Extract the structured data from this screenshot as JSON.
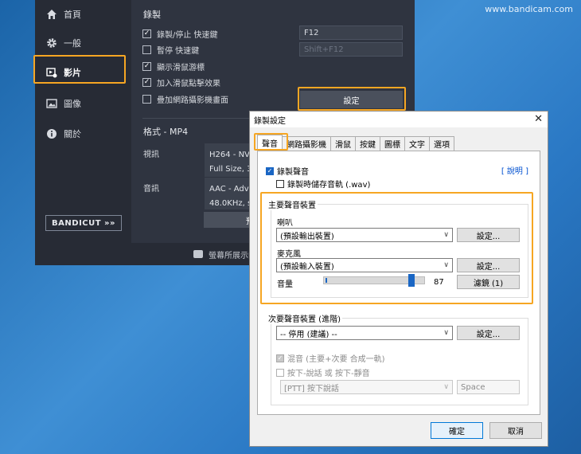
{
  "watermark": "www.bandicam.com",
  "sidebar": {
    "items": [
      {
        "label": "首頁",
        "icon": "home-icon"
      },
      {
        "label": "一般",
        "icon": "gear-icon"
      },
      {
        "label": "影片",
        "icon": "video-settings-icon"
      },
      {
        "label": "圖像",
        "icon": "image-icon"
      },
      {
        "label": "關於",
        "icon": "info-icon"
      }
    ],
    "active": "影片",
    "logo": "BANDICUT »»"
  },
  "record": {
    "title": "錄製",
    "options": [
      {
        "label": "錄製/停止 快速鍵",
        "checked": true
      },
      {
        "label": "暫停 快速鍵",
        "checked": false
      },
      {
        "label": "顯示滑鼠游標",
        "checked": true
      },
      {
        "label": "加入滑鼠點擊效果",
        "checked": true
      },
      {
        "label": "疊加網路攝影機畫面",
        "checked": false
      }
    ],
    "hotkey_record": "F12",
    "hotkey_pause": "Shift+F12",
    "settings_button": "設定"
  },
  "format": {
    "title": "格式 - MP4",
    "video_label": "視訊",
    "video_line1": "H264 - NVIDIA",
    "video_line2": "Full Size, 30fps",
    "audio_label": "音訊",
    "audio_line1": "AAC - Advanced",
    "audio_line2": "48.0KHz, stereo",
    "preset_button": "預"
  },
  "footer": {
    "text": "螢幕所展示的任何內容都"
  },
  "dialog": {
    "title": "錄製設定",
    "tabs": [
      "聲音",
      "網路攝影機",
      "滑鼠",
      "按鍵",
      "圖標",
      "文字",
      "選項"
    ],
    "active_tab": "聲音",
    "help": "[ 說明 ]",
    "record_audio": "錄製聲音",
    "save_wav": "錄製時儲存音軌 (.wav)",
    "primary": {
      "title": "主要聲音裝置",
      "speaker_label": "喇叭",
      "speaker_value": "(預設輸出裝置)",
      "speaker_settings": "設定...",
      "mic_label": "麥克風",
      "mic_value": "(預設輸入裝置)",
      "mic_settings": "設定...",
      "volume_label": "音量",
      "volume_value": "87",
      "filter_button": "濾鏡 (1)"
    },
    "secondary": {
      "title": "次要聲音裝置 (進階)",
      "device_value": "-- 停用 (建議) --",
      "device_settings": "設定...",
      "mix": "混音 (主要+次要 合成一軌)",
      "ptt": "按下-說話 或 按下-靜音",
      "ptt_value": "[PTT] 按下說話",
      "ptt_key": "Space"
    },
    "ok": "確定",
    "cancel": "取消"
  },
  "colors": {
    "highlight": "#f6a623",
    "accent": "#1a66c4",
    "app_bg": "#2f3440"
  }
}
